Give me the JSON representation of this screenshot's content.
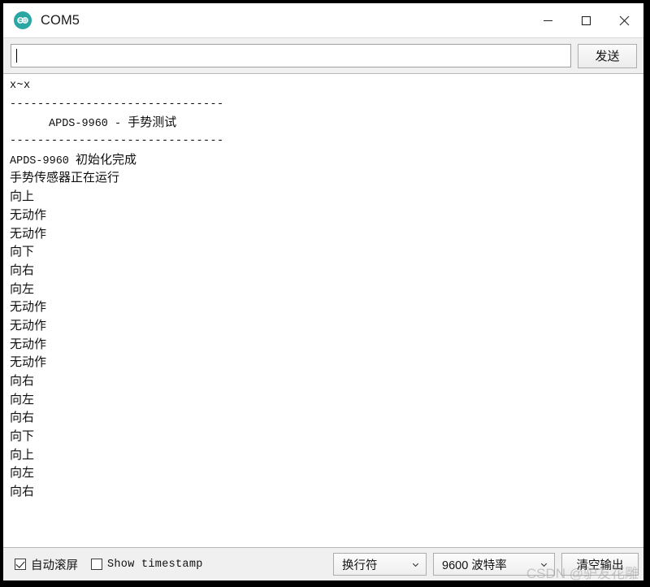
{
  "window": {
    "title": "COM5",
    "app_icon": "arduino-infinity-icon",
    "controls": {
      "minimize": "minimize-icon",
      "maximize": "maximize-icon",
      "close": "close-icon"
    }
  },
  "send_row": {
    "input_value": "",
    "input_placeholder": "",
    "send_label": "发送"
  },
  "console": {
    "lines": [
      {
        "text": "x~x",
        "style": "mono"
      },
      {
        "text": "-------------------------------",
        "style": "mono"
      },
      {
        "ascii": "APDS-9960 - ",
        "cjk": "手势测试",
        "style": "mixed-indent"
      },
      {
        "text": "-------------------------------",
        "style": "mono"
      },
      {
        "ascii": "APDS-9960 ",
        "cjk": "初始化完成",
        "style": "mixed"
      },
      {
        "text": "手势传感器正在运行",
        "style": "cjk"
      },
      {
        "text": "向上",
        "style": "cjk"
      },
      {
        "text": "无动作",
        "style": "cjk"
      },
      {
        "text": "无动作",
        "style": "cjk"
      },
      {
        "text": "向下",
        "style": "cjk"
      },
      {
        "text": "向右",
        "style": "cjk"
      },
      {
        "text": "向左",
        "style": "cjk"
      },
      {
        "text": "无动作",
        "style": "cjk"
      },
      {
        "text": "无动作",
        "style": "cjk"
      },
      {
        "text": "无动作",
        "style": "cjk"
      },
      {
        "text": "无动作",
        "style": "cjk"
      },
      {
        "text": "向右",
        "style": "cjk"
      },
      {
        "text": "向左",
        "style": "cjk"
      },
      {
        "text": "向右",
        "style": "cjk"
      },
      {
        "text": "向下",
        "style": "cjk"
      },
      {
        "text": "向上",
        "style": "cjk"
      },
      {
        "text": "向左",
        "style": "cjk"
      },
      {
        "text": "向右",
        "style": "cjk"
      }
    ]
  },
  "status_bar": {
    "autoscroll_label": "自动滚屏",
    "autoscroll_checked": true,
    "timestamp_label": "Show timestamp",
    "timestamp_checked": false,
    "line_ending_value": "换行符",
    "baud_value": "9600 波特率",
    "clear_label": "清空输出"
  },
  "watermark": "CSDN @驴友花雕",
  "colors": {
    "accent": "#2ba7a3",
    "window_bg": "#ffffff",
    "chrome_bg": "#f0f0f0",
    "text": "#0f0f0f"
  }
}
